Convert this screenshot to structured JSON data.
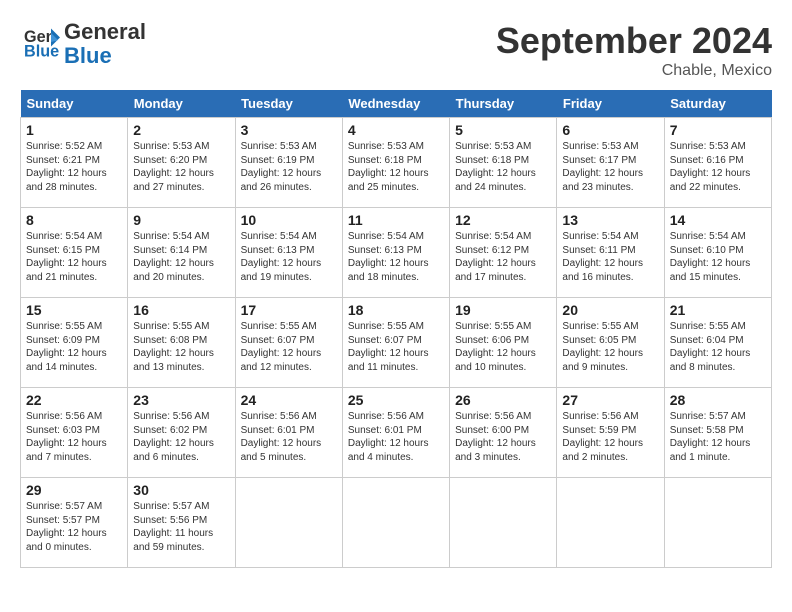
{
  "logo": {
    "line1": "General",
    "line2": "Blue"
  },
  "title": "September 2024",
  "location": "Chable, Mexico",
  "days_of_week": [
    "Sunday",
    "Monday",
    "Tuesday",
    "Wednesday",
    "Thursday",
    "Friday",
    "Saturday"
  ],
  "weeks": [
    [
      {
        "day": 1,
        "info": "Sunrise: 5:52 AM\nSunset: 6:21 PM\nDaylight: 12 hours\nand 28 minutes."
      },
      {
        "day": 2,
        "info": "Sunrise: 5:53 AM\nSunset: 6:20 PM\nDaylight: 12 hours\nand 27 minutes."
      },
      {
        "day": 3,
        "info": "Sunrise: 5:53 AM\nSunset: 6:19 PM\nDaylight: 12 hours\nand 26 minutes."
      },
      {
        "day": 4,
        "info": "Sunrise: 5:53 AM\nSunset: 6:18 PM\nDaylight: 12 hours\nand 25 minutes."
      },
      {
        "day": 5,
        "info": "Sunrise: 5:53 AM\nSunset: 6:18 PM\nDaylight: 12 hours\nand 24 minutes."
      },
      {
        "day": 6,
        "info": "Sunrise: 5:53 AM\nSunset: 6:17 PM\nDaylight: 12 hours\nand 23 minutes."
      },
      {
        "day": 7,
        "info": "Sunrise: 5:53 AM\nSunset: 6:16 PM\nDaylight: 12 hours\nand 22 minutes."
      }
    ],
    [
      {
        "day": 8,
        "info": "Sunrise: 5:54 AM\nSunset: 6:15 PM\nDaylight: 12 hours\nand 21 minutes."
      },
      {
        "day": 9,
        "info": "Sunrise: 5:54 AM\nSunset: 6:14 PM\nDaylight: 12 hours\nand 20 minutes."
      },
      {
        "day": 10,
        "info": "Sunrise: 5:54 AM\nSunset: 6:13 PM\nDaylight: 12 hours\nand 19 minutes."
      },
      {
        "day": 11,
        "info": "Sunrise: 5:54 AM\nSunset: 6:13 PM\nDaylight: 12 hours\nand 18 minutes."
      },
      {
        "day": 12,
        "info": "Sunrise: 5:54 AM\nSunset: 6:12 PM\nDaylight: 12 hours\nand 17 minutes."
      },
      {
        "day": 13,
        "info": "Sunrise: 5:54 AM\nSunset: 6:11 PM\nDaylight: 12 hours\nand 16 minutes."
      },
      {
        "day": 14,
        "info": "Sunrise: 5:54 AM\nSunset: 6:10 PM\nDaylight: 12 hours\nand 15 minutes."
      }
    ],
    [
      {
        "day": 15,
        "info": "Sunrise: 5:55 AM\nSunset: 6:09 PM\nDaylight: 12 hours\nand 14 minutes."
      },
      {
        "day": 16,
        "info": "Sunrise: 5:55 AM\nSunset: 6:08 PM\nDaylight: 12 hours\nand 13 minutes."
      },
      {
        "day": 17,
        "info": "Sunrise: 5:55 AM\nSunset: 6:07 PM\nDaylight: 12 hours\nand 12 minutes."
      },
      {
        "day": 18,
        "info": "Sunrise: 5:55 AM\nSunset: 6:07 PM\nDaylight: 12 hours\nand 11 minutes."
      },
      {
        "day": 19,
        "info": "Sunrise: 5:55 AM\nSunset: 6:06 PM\nDaylight: 12 hours\nand 10 minutes."
      },
      {
        "day": 20,
        "info": "Sunrise: 5:55 AM\nSunset: 6:05 PM\nDaylight: 12 hours\nand 9 minutes."
      },
      {
        "day": 21,
        "info": "Sunrise: 5:55 AM\nSunset: 6:04 PM\nDaylight: 12 hours\nand 8 minutes."
      }
    ],
    [
      {
        "day": 22,
        "info": "Sunrise: 5:56 AM\nSunset: 6:03 PM\nDaylight: 12 hours\nand 7 minutes."
      },
      {
        "day": 23,
        "info": "Sunrise: 5:56 AM\nSunset: 6:02 PM\nDaylight: 12 hours\nand 6 minutes."
      },
      {
        "day": 24,
        "info": "Sunrise: 5:56 AM\nSunset: 6:01 PM\nDaylight: 12 hours\nand 5 minutes."
      },
      {
        "day": 25,
        "info": "Sunrise: 5:56 AM\nSunset: 6:01 PM\nDaylight: 12 hours\nand 4 minutes."
      },
      {
        "day": 26,
        "info": "Sunrise: 5:56 AM\nSunset: 6:00 PM\nDaylight: 12 hours\nand 3 minutes."
      },
      {
        "day": 27,
        "info": "Sunrise: 5:56 AM\nSunset: 5:59 PM\nDaylight: 12 hours\nand 2 minutes."
      },
      {
        "day": 28,
        "info": "Sunrise: 5:57 AM\nSunset: 5:58 PM\nDaylight: 12 hours\nand 1 minute."
      }
    ],
    [
      {
        "day": 29,
        "info": "Sunrise: 5:57 AM\nSunset: 5:57 PM\nDaylight: 12 hours\nand 0 minutes."
      },
      {
        "day": 30,
        "info": "Sunrise: 5:57 AM\nSunset: 5:56 PM\nDaylight: 11 hours\nand 59 minutes."
      },
      null,
      null,
      null,
      null,
      null
    ]
  ]
}
